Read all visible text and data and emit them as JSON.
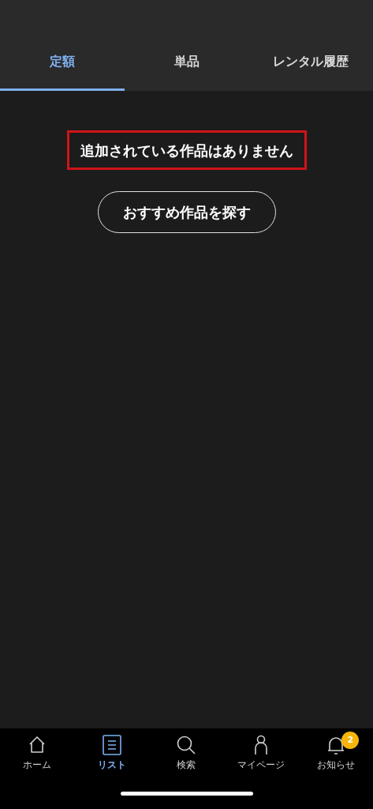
{
  "tabs": [
    {
      "label": "定額",
      "selected": true
    },
    {
      "label": "単品",
      "selected": false
    },
    {
      "label": "レンタル履歴",
      "selected": false
    }
  ],
  "empty_message": {
    "text": "追加されている作品はありません",
    "highlighted": true
  },
  "action_button": "おすすめ作品を探す",
  "bottom_nav": [
    {
      "kind": "home",
      "label": "ホーム",
      "selected": false
    },
    {
      "kind": "list",
      "label": "リスト",
      "selected": true
    },
    {
      "kind": "search",
      "label": "検索",
      "selected": false
    },
    {
      "kind": "person",
      "label": "マイページ",
      "selected": false
    },
    {
      "kind": "bell",
      "label": "お知らせ",
      "selected": false,
      "badge": "2"
    }
  ]
}
